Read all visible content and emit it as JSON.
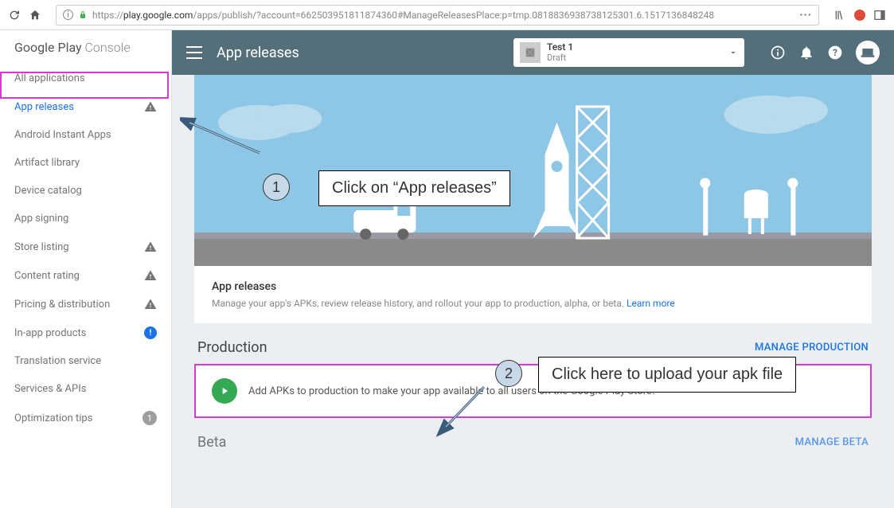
{
  "browser": {
    "url_prefix": "https://",
    "url_host": "play.google.com",
    "url_path": "/apps/publish/?account=662503951811874360#ManageReleasesPlace:p=tmp.0818836938738125301.6.1517136848248",
    "dots": "···"
  },
  "sidebar": {
    "logo_part1": "Google Play",
    "logo_part2": " Console",
    "items": [
      {
        "label": "All applications",
        "icon": null
      },
      {
        "label": "App releases",
        "icon": "warn",
        "active": true
      },
      {
        "label": "Android Instant Apps",
        "icon": null
      },
      {
        "label": "Artifact library",
        "icon": null
      },
      {
        "label": "Device catalog",
        "icon": null
      },
      {
        "label": "App signing",
        "icon": null
      },
      {
        "label": "Store listing",
        "icon": "warn"
      },
      {
        "label": "Content rating",
        "icon": "warn"
      },
      {
        "label": "Pricing & distribution",
        "icon": "warn"
      },
      {
        "label": "In-app products",
        "icon": "blue-alert"
      },
      {
        "label": "Translation service",
        "icon": null
      },
      {
        "label": "Services & APIs",
        "icon": null
      },
      {
        "label": "Optimization tips",
        "icon": "count",
        "count": "1"
      }
    ]
  },
  "topbar": {
    "title": "App releases",
    "app_name": "Test 1",
    "app_status": "Draft"
  },
  "hero": {
    "title": "App releases",
    "desc": "Manage your app's APKs, review release history, and rollout your app to production, alpha, or beta. ",
    "learn_more": "Learn more"
  },
  "sections": {
    "production": {
      "title": "Production",
      "action": "MANAGE PRODUCTION",
      "add_text": "Add APKs to production to make your app available to all users on the Google Play Store."
    },
    "beta": {
      "title": "Beta",
      "action": "MANAGE BETA"
    }
  },
  "annotations": {
    "step1_num": "1",
    "step1_text": "Click on “App releases”",
    "step2_num": "2",
    "step2_text": "Click here to upload your apk file"
  }
}
